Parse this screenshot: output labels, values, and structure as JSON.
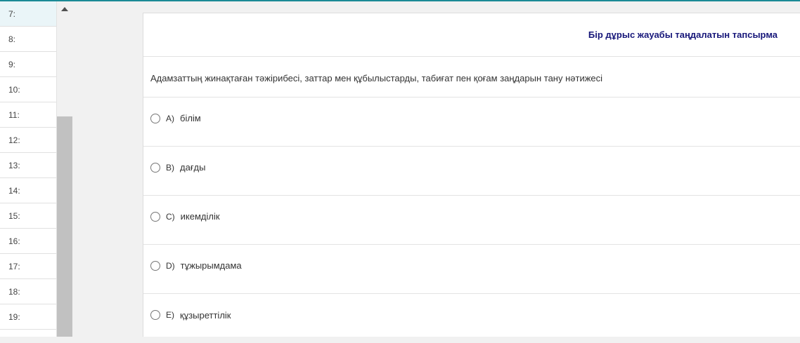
{
  "question_list": {
    "items": [
      {
        "label": "7:"
      },
      {
        "label": "8:"
      },
      {
        "label": "9:"
      },
      {
        "label": "10:"
      },
      {
        "label": "11:"
      },
      {
        "label": "12:"
      },
      {
        "label": "13:"
      },
      {
        "label": "14:"
      },
      {
        "label": "15:"
      },
      {
        "label": "16:"
      },
      {
        "label": "17:"
      },
      {
        "label": "18:"
      },
      {
        "label": "19:"
      }
    ],
    "active_index": 0
  },
  "header": {
    "task_type": "Бір дұрыс жауабы таңдалатын тапсырма"
  },
  "question": {
    "text": "Адамзаттың жинақтаған тәжірибесі, заттар мен құбылыстарды, табиғат пен қоғам заңдарын тану нәтижесі"
  },
  "options": [
    {
      "letter": "A)",
      "text": "білім"
    },
    {
      "letter": "B)",
      "text": "дағды"
    },
    {
      "letter": "C)",
      "text": "икемділік"
    },
    {
      "letter": "D)",
      "text": "тұжырымдама"
    },
    {
      "letter": "E)",
      "text": "құзыреттілік"
    }
  ],
  "colors": {
    "accent": "#1b8a96",
    "task_type_text": "#17177a",
    "active_item_bg": "#eaf5f8"
  }
}
